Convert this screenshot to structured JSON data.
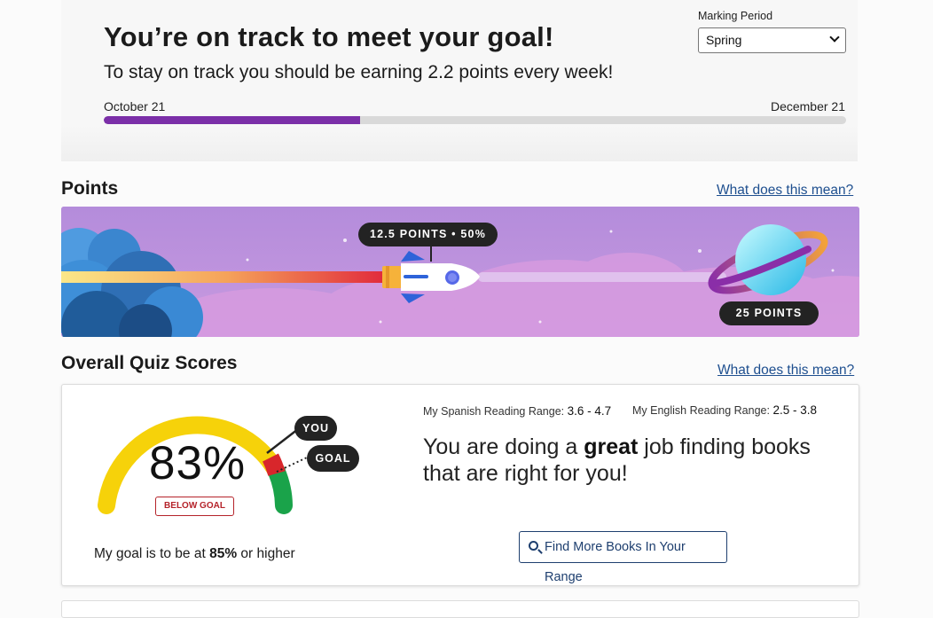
{
  "goal": {
    "headline": "You’re on track to meet your goal!",
    "subline": "To stay on track you should be earning 2.2 points every week!",
    "start_date": "October 21",
    "end_date": "December 21",
    "progress_fraction": 0.345
  },
  "marking_period": {
    "label": "Marking Period",
    "selected": "Spring"
  },
  "points": {
    "title": "Points",
    "help_link": "What does this mean?",
    "current_label": "12.5 POINTS • 50%",
    "target_label": "25 POINTS",
    "current": 12.5,
    "target": 25,
    "percent": 50
  },
  "quiz": {
    "title": "Overall Quiz Scores",
    "help_link": "What does this mean?",
    "score": "83%",
    "status_badge": "BELOW GOAL",
    "you_label": "YOU",
    "goal_label": "GOAL",
    "goal_prefix": "My goal is to be at ",
    "goal_value": "85%",
    "goal_suffix": " or higher",
    "spanish_range_label": "My Spanish Reading Range:",
    "spanish_range_value": "3.6 - 4.7",
    "english_range_label": "My English Reading Range:",
    "english_range_value": "2.5 - 3.8",
    "message_1": "You are doing a ",
    "message_bold": "great",
    "message_2": " job finding books that are right for you!",
    "find_button": "Find More Books In Your Range"
  },
  "colors": {
    "progress": "#7b2fa8",
    "gauge_yellow": "#f6d20a",
    "gauge_green": "#1aa34a",
    "gauge_red": "#d8262b",
    "link": "#1e4f8f"
  }
}
